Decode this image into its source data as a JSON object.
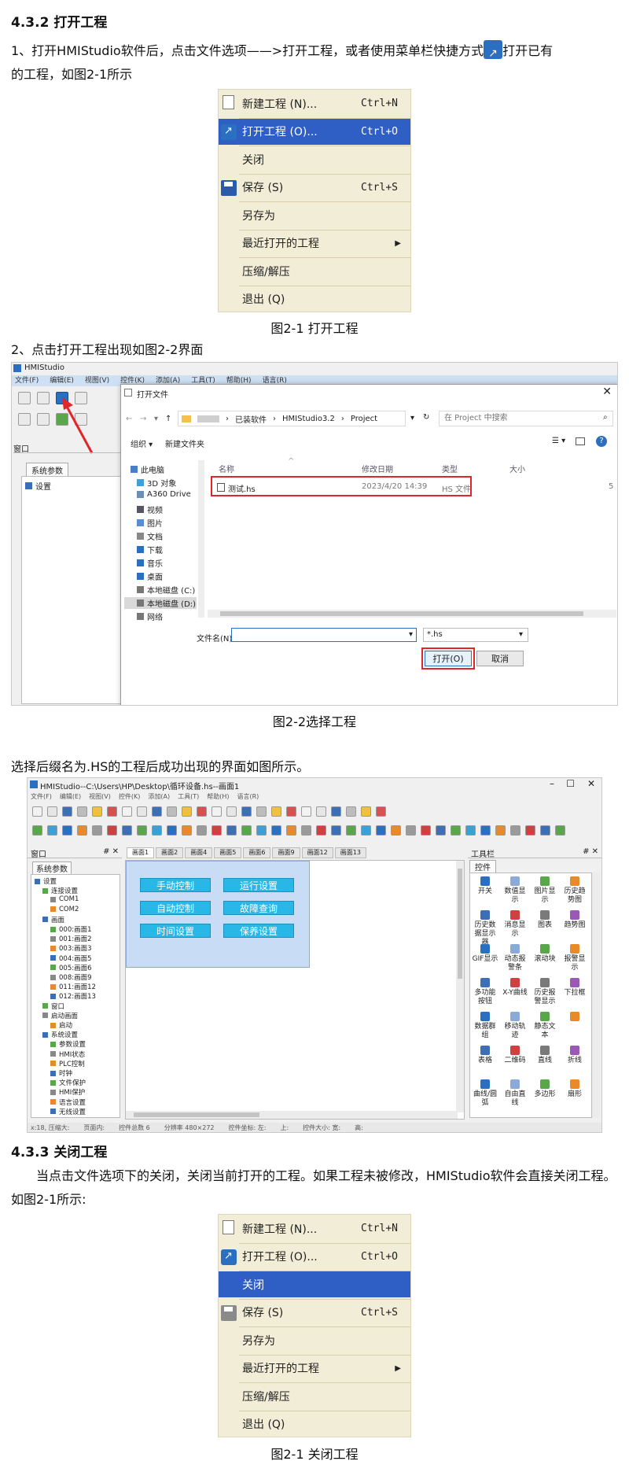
{
  "section1": {
    "heading": "4.3.2 打开工程",
    "para_line1a": "1、打开HMIStudio软件后，点击文件选项——>打开工程，或者使用菜单栏快捷方式",
    "para_line1b": "打开已有",
    "para_line2": "的工程，如图2-1所示"
  },
  "menu": {
    "items": [
      {
        "label": "新建工程 (N)...",
        "shortcut": "Ctrl+N",
        "icon": "new-doc-icon"
      },
      {
        "label": "打开工程 (O)...",
        "shortcut": "Ctrl+O",
        "icon": "open-project-icon"
      },
      {
        "label": "关闭",
        "shortcut": "",
        "icon": ""
      },
      {
        "label": "保存 (S)",
        "shortcut": "Ctrl+S",
        "icon": "save-icon"
      },
      {
        "label": "另存为",
        "shortcut": "",
        "icon": ""
      },
      {
        "label": "最近打开的工程",
        "shortcut": "",
        "icon": "",
        "submenu_arrow": "▶"
      },
      {
        "label": "压缩/解压",
        "shortcut": "",
        "icon": ""
      },
      {
        "label": "退出 (Q)",
        "shortcut": "",
        "icon": ""
      }
    ],
    "selected_color": "#2f5fc4",
    "background_color": "#f2edd6"
  },
  "fig1_caption": "图2-1 打开工程",
  "step2": "2、点击打开工程出现如图2-2界面",
  "open_dialog_shot": {
    "app_title": "HMIStudio",
    "menubar": [
      "文件(F)",
      "编辑(E)",
      "视图(V)",
      "控件(K)",
      "添加(A)",
      "工具(T)",
      "帮助(H)",
      "语言(R)"
    ],
    "side_label": "窗口",
    "side_tab": "系统参数",
    "side_tree_item": "设置",
    "dialog_title": "打开文件",
    "nav_path": [
      "已装软件",
      "HMIStudio3.2",
      "Project"
    ],
    "search_placeholder": "在 Project 中搜索",
    "organize": "组织 ▾",
    "new_folder": "新建文件夹",
    "nav_tree": [
      "此电脑",
      "3D 对象",
      "A360 Drive",
      "视频",
      "图片",
      "文档",
      "下载",
      "音乐",
      "桌面",
      "本地磁盘 (C:)",
      "本地磁盘 (D:)",
      "网络"
    ],
    "columns": [
      "名称",
      "修改日期",
      "类型",
      "大小"
    ],
    "file": {
      "name": "测试.hs",
      "date": "2023/4/20 14:39",
      "type": "HS 文件",
      "size": "5"
    },
    "filename_label": "文件名(N):",
    "filter": "*.hs",
    "open_button": "打开(O)",
    "cancel_button": "取消",
    "highlight_color": "#e0262b"
  },
  "fig2_caption": "图2-2选择工程",
  "step3": "选择后缀名为.HS的工程后成功出现的界面如图所示。",
  "main_shot": {
    "title": "HMIStudio--C:\\Users\\HP\\Desktop\\循环设备.hs--画面1",
    "menubar": [
      "文件(F)",
      "编辑(E)",
      "视图(V)",
      "控件(K)",
      "添加(A)",
      "工具(T)",
      "帮助(H)",
      "语言(R)"
    ],
    "left_panel_title": "窗口",
    "left_tab": "系统参数",
    "tree": [
      "设置",
      "连接设置",
      "COM1",
      "COM2",
      "画面",
      "000:画面1",
      "001:画面2",
      "003:画面3",
      "004:画面5",
      "005:画面6",
      "008:画面9",
      "011:画面12",
      "012:画面13",
      "窗口",
      "启动画面",
      "启动",
      "系统设置",
      "参数设置",
      "HMI状态",
      "PLC控制",
      "时钟",
      "文件保护",
      "HMI保护",
      "语言设置",
      "无线设置"
    ],
    "tabs": [
      "画面1",
      "画面2",
      "画面4",
      "画面5",
      "画面6",
      "画面9",
      "画面12",
      "画面13"
    ],
    "buttons": [
      "手动控制",
      "运行设置",
      "自动控制",
      "故障查询",
      "时间设置",
      "保养设置"
    ],
    "right_panel_title": "工具栏",
    "right_tab": "控件",
    "tools": [
      "开关",
      "数值显示",
      "图片显示",
      "历史趋势图",
      "历史数据显示器",
      "消息显示",
      "图表",
      "趋势图",
      "GIF显示",
      "动态报警条",
      "滚动块",
      "报警显示",
      "多功能按钮",
      "X-Y曲线",
      "历史报警显示",
      "下拉框",
      "数据群组",
      "移动轨迹",
      "静态文本",
      "",
      "表格",
      "二维码",
      "直线",
      "折线",
      "曲线/圆弧",
      "自由直线",
      "多边形",
      "扇形"
    ],
    "status": [
      "x:18, 压缩大:",
      "页面内:",
      "控件总数 6",
      "分辨率 480×272",
      "控件坐标: 左:",
      "上:",
      "控件大小: 宽:",
      "高:"
    ]
  },
  "section2": {
    "heading": "4.3.3 关闭工程",
    "para": "当点击文件选项下的关闭，关闭当前打开的工程。如果工程未被修改，HMIStudio软件会直接关闭工程。如图2-1所示:"
  },
  "fig3_caption": "图2-1 关闭工程"
}
